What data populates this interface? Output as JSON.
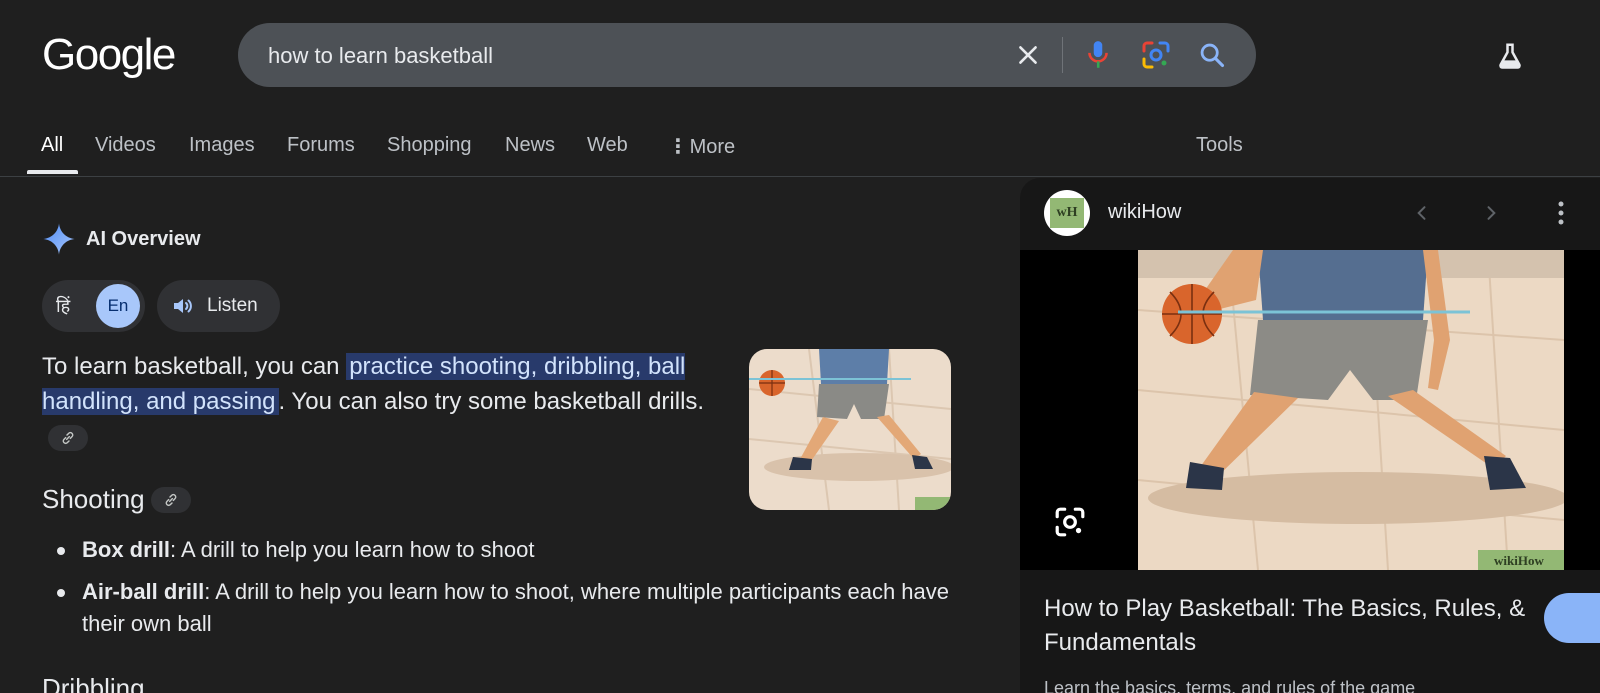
{
  "header": {
    "logo": "Google",
    "search_query": "how to learn basketball",
    "icons": [
      "close-icon",
      "mic-icon",
      "lens-icon",
      "search-icon",
      "labs-icon"
    ]
  },
  "tabs": [
    {
      "label": "All",
      "active": true
    },
    {
      "label": "Videos"
    },
    {
      "label": "Images"
    },
    {
      "label": "Forums"
    },
    {
      "label": "Shopping"
    },
    {
      "label": "News"
    },
    {
      "label": "Web"
    },
    {
      "label": "More"
    },
    {
      "label": "Tools"
    }
  ],
  "ai_overview": {
    "title": "AI Overview",
    "lang_hi": "हिं",
    "lang_en": "En",
    "listen": "Listen",
    "summary_pre": "To learn basketball, you can ",
    "summary_highlight": "practice shooting, dribbling, ball handling, and passing",
    "summary_post": ". You can also try some basket­ball drills.",
    "section_heading": "Shooting",
    "bullets": [
      {
        "term": "Box drill",
        "text": ": A drill to help you learn how to shoot"
      },
      {
        "term": "Air-ball drill",
        "text": ": A drill to help you learn how to shoot, where multiple participants each have their own ball"
      }
    ],
    "next_section": "Dribbling"
  },
  "side_panel": {
    "source_logo": "wH",
    "source_name": "wikiHow",
    "watermark": "wikiHow",
    "title": "How to Play Basketball: The Basics, Rules, & Fundamentals",
    "subtitle": "Learn the basics, terms, and rules of the game"
  },
  "colors": {
    "background": "#1f1f1f",
    "search_bg": "#4d5156",
    "highlight_bg": "#283a6b",
    "accent_blue": "#8ab4f8"
  }
}
